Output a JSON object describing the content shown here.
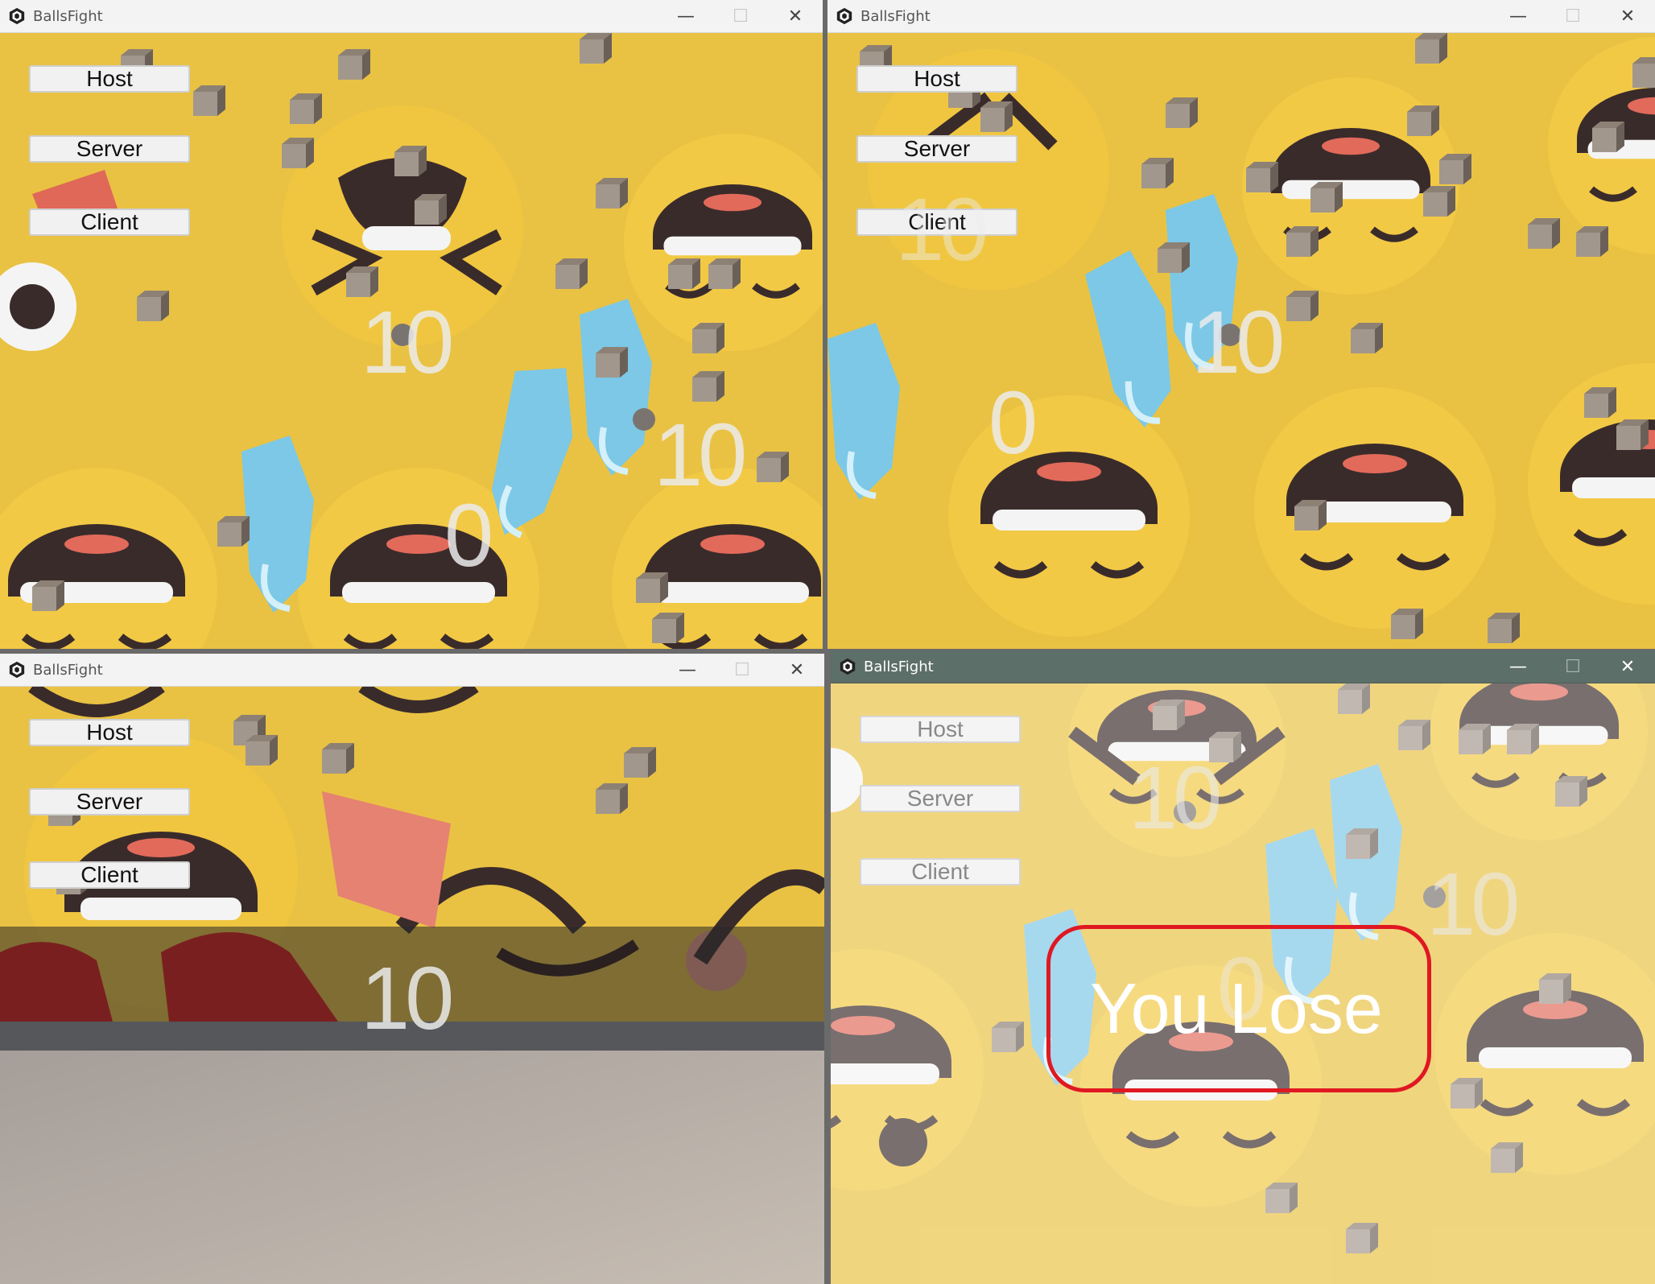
{
  "windows": [
    {
      "title": "BallsFight",
      "buttons": {
        "host": "Host",
        "server": "Server",
        "client": "Client"
      },
      "scores": [
        "10",
        "10",
        "0"
      ]
    },
    {
      "title": "BallsFight",
      "buttons": {
        "host": "Host",
        "server": "Server",
        "client": "Client"
      },
      "scores": [
        "10",
        "10",
        "0"
      ]
    },
    {
      "title": "BallsFight",
      "buttons": {
        "host": "Host",
        "server": "Server",
        "client": "Client"
      },
      "scores": [
        "10"
      ]
    },
    {
      "title": "BallsFight",
      "buttons": {
        "host": "Host",
        "server": "Server",
        "client": "Client"
      },
      "scores": [
        "10",
        "10",
        "0"
      ],
      "result_text": "You Lose"
    }
  ],
  "window_controls": {
    "minimize": "—",
    "maximize": "☐",
    "close": "✕"
  },
  "colors": {
    "background_yellow": "#e9c243",
    "emoji_dark": "#3a2b2b",
    "accent_blue": "#7cc8e6",
    "highlight_red": "#e01822",
    "active_titlebar": "#5c6f68"
  },
  "icons": [
    "unity-logo-icon",
    "minimize-icon",
    "maximize-icon",
    "close-icon"
  ]
}
